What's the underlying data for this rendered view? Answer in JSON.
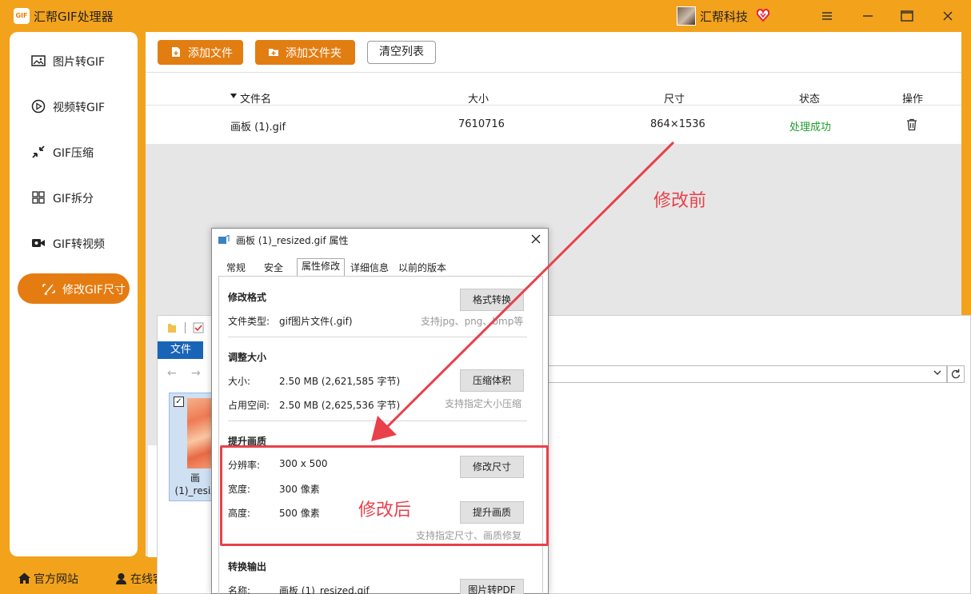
{
  "app": {
    "title": "汇帮GIF处理器",
    "logo_text": "GIF",
    "user_name": "汇帮科技"
  },
  "sidebar": {
    "items": [
      {
        "label": "图片转GIF",
        "icon": "image-icon"
      },
      {
        "label": "视频转GIF",
        "icon": "play-icon"
      },
      {
        "label": "GIF压缩",
        "icon": "compress-icon"
      },
      {
        "label": "GIF拆分",
        "icon": "split-icon"
      },
      {
        "label": "GIF转视频",
        "icon": "video-icon"
      },
      {
        "label": "修改GIF尺寸",
        "icon": "resize-icon",
        "active": true
      }
    ]
  },
  "bottom_links": {
    "website": "官方网站",
    "online": "在线客"
  },
  "toolbar": {
    "add_file": "添加文件",
    "add_folder": "添加文件夹",
    "clear_list": "清空列表"
  },
  "table": {
    "headers": {
      "name": "文件名",
      "size": "大小",
      "dimensions": "尺寸",
      "status": "状态",
      "action": "操作"
    },
    "rows": [
      {
        "name": "画板 (1).gif",
        "size": "7610716",
        "dimensions": "864×1536",
        "status": "处理成功"
      }
    ]
  },
  "explorer": {
    "file_tab": "文件",
    "thumb_label_1": "画",
    "thumb_label_2": "(1)_resiz"
  },
  "dialog": {
    "title": "画板 (1)_resized.gif 属性",
    "tabs": [
      "常规",
      "安全",
      "属性修改",
      "详细信息",
      "以前的版本"
    ],
    "format_section": {
      "title": "修改格式",
      "file_type_label": "文件类型:",
      "file_type_value": "gif图片文件(.gif)",
      "button": "格式转换",
      "hint": "支持jpg、png、bmp等"
    },
    "size_section": {
      "title": "调整大小",
      "size_label": "大小:",
      "size_value": "2.50 MB (2,621,585 字节)",
      "disk_label": "占用空间:",
      "disk_value": "2.50 MB (2,625,536 字节)",
      "button": "压缩体积",
      "hint": "支持指定大小压缩"
    },
    "quality_section": {
      "title": "提升画质",
      "resolution_label": "分辨率:",
      "resolution_value": "300 x 500",
      "width_label": "宽度:",
      "width_value": "300 像素",
      "height_label": "高度:",
      "height_value": "500 像素",
      "resize_button": "修改尺寸",
      "enhance_button": "提升画质",
      "hint": "支持指定尺寸、画质修复"
    },
    "output_section": {
      "title": "转换输出",
      "name_label": "名称:",
      "name_value": "画板 (1)_resized.gif",
      "button": "图片转PDF"
    }
  },
  "annotations": {
    "before": "修改前",
    "after": "修改后",
    "color": "#e8414b"
  },
  "colors": {
    "brand": "#f3a21b",
    "button_orange": "#e27d12",
    "success": "#1f9d2b"
  }
}
